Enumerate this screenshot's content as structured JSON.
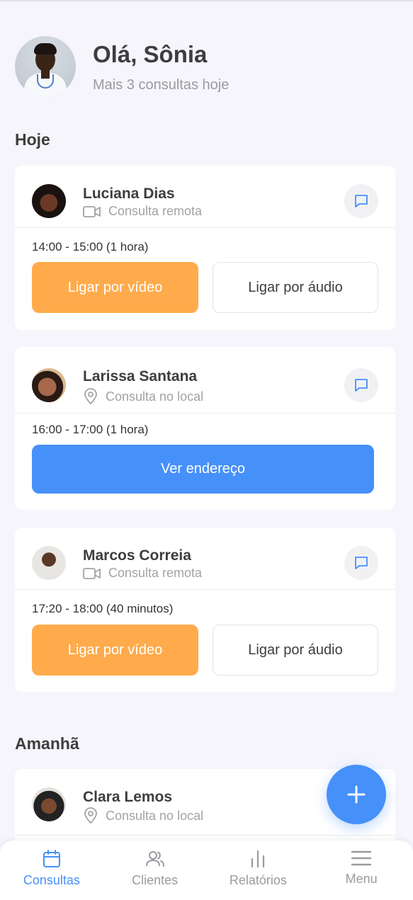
{
  "header": {
    "greeting": "Olá, Sônia",
    "subtitle": "Mais 3 consultas hoje"
  },
  "sections": {
    "today": "Hoje",
    "tomorrow": "Amanhã"
  },
  "appointments": [
    {
      "name": "Luciana Dias",
      "type": "Consulta remota",
      "type_icon": "video-icon",
      "time": "14:00 - 15:00 (1 hora)",
      "video_label": "Ligar por vídeo",
      "audio_label": "Ligar por áudio"
    },
    {
      "name": "Larissa Santana",
      "type": "Consulta no local",
      "type_icon": "location-pin-icon",
      "time": "16:00 - 17:00 (1 hora)",
      "address_label": "Ver endereço"
    },
    {
      "name": "Marcos Correia",
      "type": "Consulta remota",
      "type_icon": "video-icon",
      "time": "17:20 - 18:00 (40 minutos)",
      "video_label": "Ligar por vídeo",
      "audio_label": "Ligar por áudio"
    },
    {
      "name": "Clara Lemos",
      "type": "Consulta no local",
      "type_icon": "location-pin-icon"
    }
  ],
  "nav": [
    {
      "label": "Consultas",
      "icon": "calendar-icon",
      "active": true
    },
    {
      "label": "Clientes",
      "icon": "users-icon",
      "active": false
    },
    {
      "label": "Relatórios",
      "icon": "bar-chart-icon",
      "active": false
    },
    {
      "label": "Menu",
      "icon": "menu-icon",
      "active": false
    }
  ],
  "colors": {
    "accent_blue": "#4690f9",
    "accent_orange": "#ffab4c",
    "background": "#f6f5fb"
  }
}
